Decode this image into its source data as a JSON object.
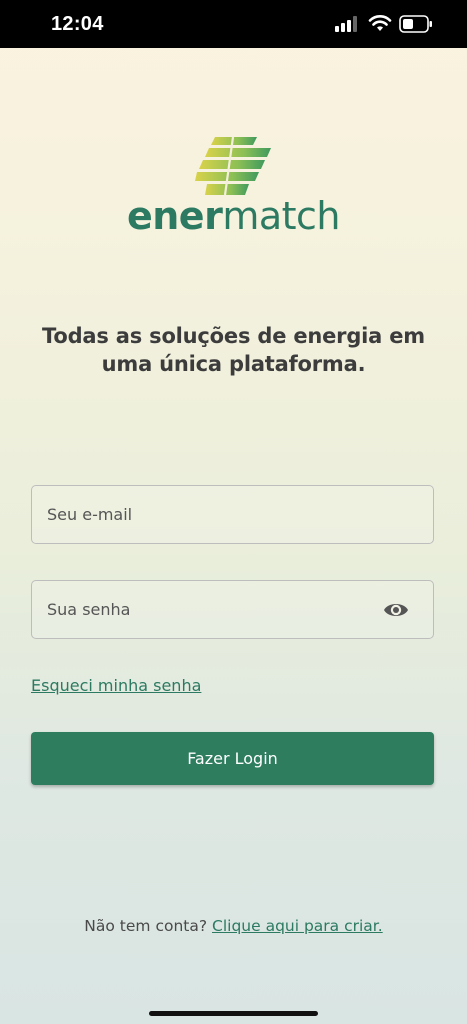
{
  "status_bar": {
    "time": "12:04",
    "icons": [
      "signal-icon",
      "wifi-icon",
      "battery-icon"
    ]
  },
  "brand": {
    "name_part1": "ener",
    "name_part2": "match",
    "color": "#2c7a62",
    "logo_icon": "solar-panel-icon"
  },
  "tagline": "Todas as soluções de energia em uma única plataforma.",
  "form": {
    "email_placeholder": "Seu e-mail",
    "email_value": "",
    "password_placeholder": "Sua senha",
    "password_value": "",
    "password_toggle_icon": "eye-icon",
    "forgot_password": "Esqueci minha senha",
    "login_button": "Fazer Login"
  },
  "signup": {
    "prompt": "Não tem conta?",
    "link": "Clique aqui para criar."
  },
  "colors": {
    "primary": "#2e7d5f",
    "text": "#3c3c3c"
  }
}
